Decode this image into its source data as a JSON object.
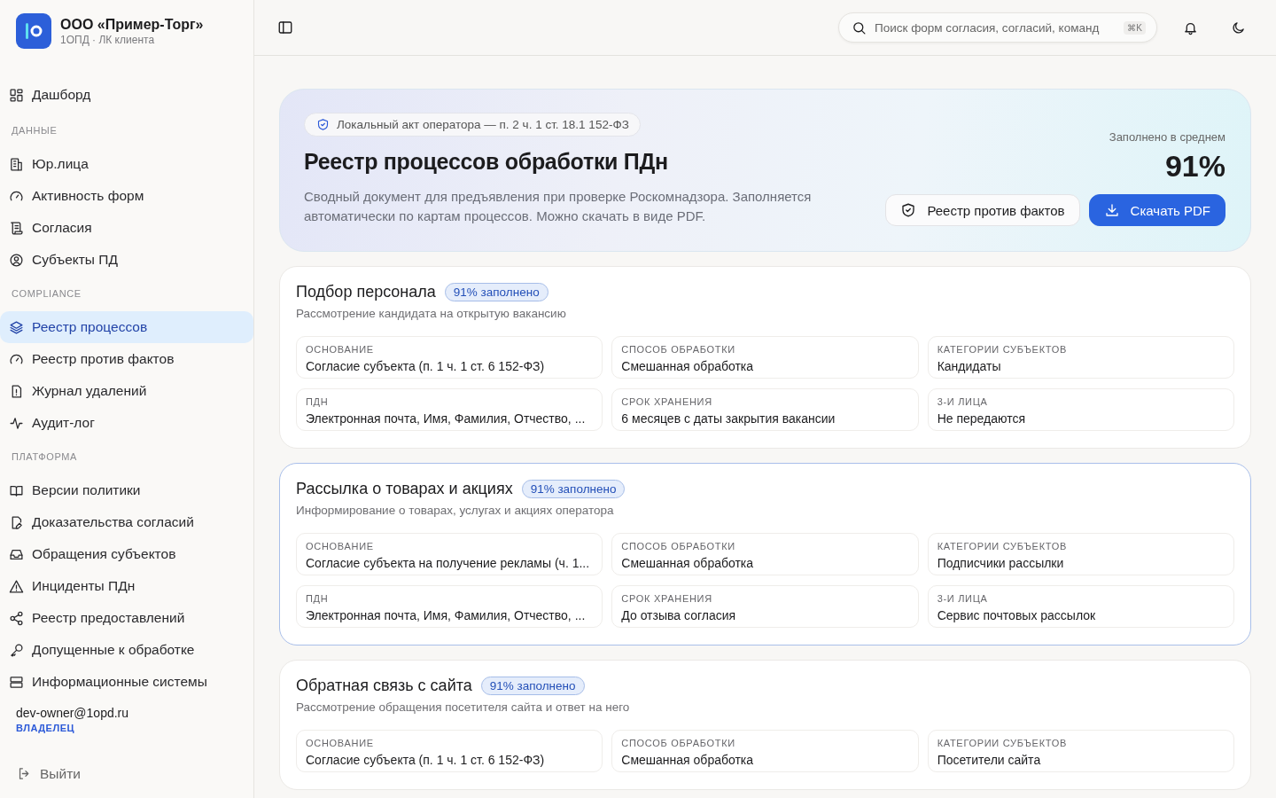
{
  "sidebar": {
    "org": {
      "name": "ООО «Пример-Торг»",
      "subtitle": "1ОПД · ЛК клиента"
    },
    "nav": [
      {
        "kind": "item",
        "label": "Дашборд",
        "selected": false
      },
      {
        "kind": "section",
        "label": "ДАННЫЕ"
      },
      {
        "kind": "item",
        "label": "Юр.лица",
        "selected": false
      },
      {
        "kind": "item",
        "label": "Активность форм",
        "selected": false
      },
      {
        "kind": "item",
        "label": "Согласия",
        "selected": false
      },
      {
        "kind": "item",
        "label": "Субъекты ПД",
        "selected": false
      },
      {
        "kind": "section",
        "label": "COMPLIANCE"
      },
      {
        "kind": "item",
        "label": "Реестр процессов",
        "selected": true
      },
      {
        "kind": "item",
        "label": "Реестр против фактов",
        "selected": false
      },
      {
        "kind": "item",
        "label": "Журнал удалений",
        "selected": false
      },
      {
        "kind": "item",
        "label": "Аудит-лог",
        "selected": false
      },
      {
        "kind": "section",
        "label": "ПЛАТФОРМА"
      },
      {
        "kind": "item",
        "label": "Версии политики",
        "selected": false
      },
      {
        "kind": "item",
        "label": "Доказательства согласий",
        "selected": false
      },
      {
        "kind": "item",
        "label": "Обращения субъектов",
        "selected": false
      },
      {
        "kind": "item",
        "label": "Инциденты ПДн",
        "selected": false
      },
      {
        "kind": "item",
        "label": "Реестр предоставлений",
        "selected": false
      },
      {
        "kind": "item",
        "label": "Допущенные к обработке",
        "selected": false
      },
      {
        "kind": "item",
        "label": "Информационные системы",
        "selected": false
      }
    ],
    "user": {
      "email": "dev-owner@1opd.ru",
      "role": "ВЛАДЕЛЕЦ"
    },
    "logout": "Выйти"
  },
  "topbar": {
    "search": {
      "placeholder": "Поиск форм согласия, согласий, команд",
      "shortcut": "⌘K"
    }
  },
  "hero": {
    "badge": "Локальный акт оператора — п. 2 ч. 1 ст. 18.1 152-ФЗ",
    "title": "Реестр процессов обработки ПДн",
    "description": "Сводный документ для предъявления при проверке Роскомнадзора. Заполняется автоматически по картам процессов. Можно скачать в виде PDF.",
    "stat_label": "Заполнено в среднем",
    "stat_value": "91%",
    "buttons": [
      {
        "kind": "secondary",
        "label": "Реестр против фактов"
      },
      {
        "kind": "primary",
        "label": "Скачать PDF"
      }
    ]
  },
  "processes": [
    {
      "title": "Подбор персонала",
      "fill_badge": "91% заполнено",
      "description": "Рассмотрение кандидата на открытую вакансию",
      "highlighted": false,
      "fields": [
        {
          "label": "ОСНОВАНИЕ",
          "value": "Согласие субъекта (п. 1 ч. 1 ст. 6 152-ФЗ)"
        },
        {
          "label": "СПОСОБ ОБРАБОТКИ",
          "value": "Смешанная обработка"
        },
        {
          "label": "КАТЕГОРИИ СУБЪЕКТОВ",
          "value": "Кандидаты"
        },
        {
          "label": "ПДН",
          "value": "Электронная почта, Имя, Фамилия, Отчество, ..."
        },
        {
          "label": "СРОК ХРАНЕНИЯ",
          "value": "6 месяцев с даты закрытия вакансии"
        },
        {
          "label": "3-И ЛИЦА",
          "value": "Не передаются"
        }
      ]
    },
    {
      "title": "Рассылка о товарах и акциях",
      "fill_badge": "91% заполнено",
      "description": "Информирование о товарах, услугах и акциях оператора",
      "highlighted": true,
      "fields": [
        {
          "label": "ОСНОВАНИЕ",
          "value": "Согласие субъекта на получение рекламы (ч. 1..."
        },
        {
          "label": "СПОСОБ ОБРАБОТКИ",
          "value": "Смешанная обработка"
        },
        {
          "label": "КАТЕГОРИИ СУБЪЕКТОВ",
          "value": "Подписчики рассылки"
        },
        {
          "label": "ПДН",
          "value": "Электронная почта, Имя, Фамилия, Отчество, ..."
        },
        {
          "label": "СРОК ХРАНЕНИЯ",
          "value": "До отзыва согласия"
        },
        {
          "label": "3-И ЛИЦА",
          "value": "Сервис почтовых рассылок"
        }
      ]
    },
    {
      "title": "Обратная связь с сайта",
      "fill_badge": "91% заполнено",
      "description": "Рассмотрение обращения посетителя сайта и ответ на него",
      "highlighted": false,
      "fields": [
        {
          "label": "ОСНОВАНИЕ",
          "value": "Согласие субъекта (п. 1 ч. 1 ст. 6 152-ФЗ)"
        },
        {
          "label": "СПОСОБ ОБРАБОТКИ",
          "value": "Смешанная обработка"
        },
        {
          "label": "КАТЕГОРИИ СУБЪЕКТОВ",
          "value": "Посетители сайта"
        }
      ]
    }
  ]
}
